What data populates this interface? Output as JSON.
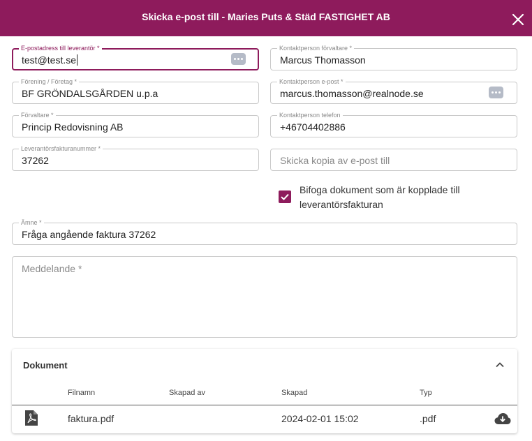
{
  "dialog": {
    "title": "Skicka e-post till - Maries Puts & Städ FASTIGHET AB",
    "close_icon": "close-icon"
  },
  "form": {
    "supplier_email": {
      "label": "E-postadress till leverantör *",
      "value": "test@test.se"
    },
    "association": {
      "label": "Förening / Företag *",
      "value": "BF GRÖNDALSGÅRDEN u.p.a"
    },
    "manager": {
      "label": "Förvaltare *",
      "value": "Princip Redovisning AB"
    },
    "supplier_invoice_number": {
      "label": "Leverantörsfakturanummer *",
      "value": "37262"
    },
    "contact_manager": {
      "label": "Kontaktperson förvaltare *",
      "value": "Marcus Thomasson"
    },
    "contact_email": {
      "label": "Kontaktperson e-post *",
      "value": "marcus.thomasson@realnode.se"
    },
    "contact_phone": {
      "label": "Kontaktperson telefon",
      "value": "+46704402886"
    },
    "cc_email": {
      "placeholder": "Skicka kopia av e-post till",
      "value": ""
    },
    "attach_documents": {
      "label": "Bifoga dokument som är kopplade till leverantörsfakturan",
      "checked": true
    },
    "subject": {
      "label": "Ämne *",
      "value": "Fråga angående faktura 37262"
    },
    "message": {
      "placeholder": "Meddelande *",
      "value": ""
    }
  },
  "documents": {
    "title": "Dokument",
    "expanded": true,
    "columns": [
      "Filnamn",
      "Skapad av",
      "Skapad",
      "Typ"
    ],
    "rows": [
      {
        "icon": "pdf-file-icon",
        "filename": "faktura.pdf",
        "created_by": "",
        "created": "2024-02-01 15:02",
        "type": ".pdf",
        "action_icon": "cloud-download-icon"
      }
    ]
  },
  "colors": {
    "brand": "#8e1b5c",
    "border": "#c9c9c9",
    "label": "#8a8a8a",
    "key_button": "#b5bbc7"
  }
}
